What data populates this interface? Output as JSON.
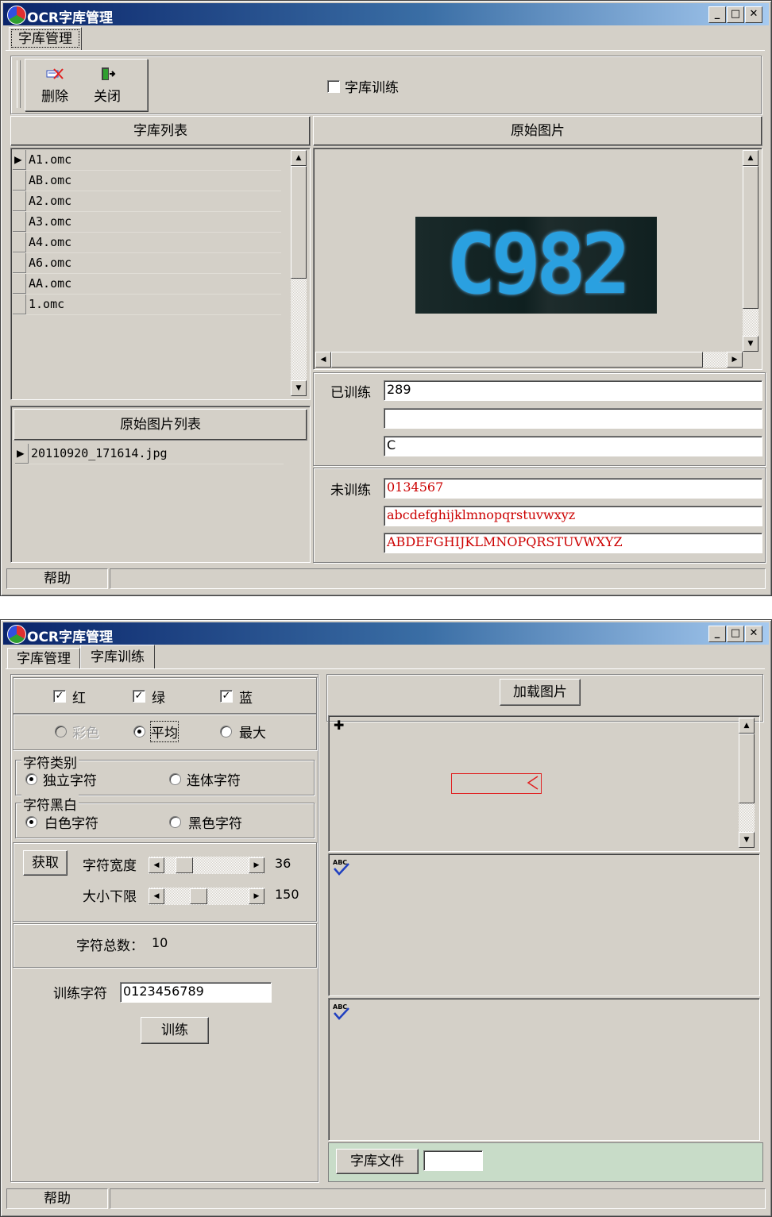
{
  "window1": {
    "title": "OCR字库管理",
    "tabs": [
      {
        "label": "字库管理",
        "active": true
      }
    ],
    "toolbar": {
      "delete_label": "删除",
      "close_label": "关闭"
    },
    "train_checkbox": {
      "label": "字库训练",
      "checked": false
    },
    "lib_list": {
      "header": "字库列表",
      "items": [
        "A1.omc",
        "AB.omc",
        "A2.omc",
        "A3.omc",
        "A4.omc",
        "A6.omc",
        "AA.omc",
        "1.omc"
      ]
    },
    "image_list": {
      "header": "原始图片列表",
      "items": [
        "20110920_171614.jpg"
      ]
    },
    "preview": {
      "header": "原始图片",
      "image_text": "C982"
    },
    "trained": {
      "label": "已训练",
      "values": [
        "289",
        "",
        "C"
      ]
    },
    "untrained": {
      "label": "未训练",
      "values": [
        "0134567",
        "abcdefghijklmnopqrstuvwxyz",
        "ABDEFGHIJKLMNOPQRSTUVWXYZ"
      ]
    },
    "status": {
      "help": "帮助"
    }
  },
  "window2": {
    "title": "OCR字库管理",
    "tabs": [
      {
        "label": "字库管理",
        "active": false
      },
      {
        "label": "字库训练",
        "active": true
      }
    ],
    "channels": [
      {
        "label": "红",
        "checked": true
      },
      {
        "label": "绿",
        "checked": true
      },
      {
        "label": "蓝",
        "checked": true
      }
    ],
    "modes": [
      {
        "label": "彩色",
        "selected": false,
        "disabled": true
      },
      {
        "label": "平均",
        "selected": true,
        "disabled": false
      },
      {
        "label": "最大",
        "selected": false,
        "disabled": false
      }
    ],
    "char_type": {
      "title": "字符类别",
      "options": [
        {
          "label": "独立字符",
          "selected": true
        },
        {
          "label": "连体字符",
          "selected": false
        }
      ]
    },
    "char_bw": {
      "title": "字符黑白",
      "options": [
        {
          "label": "白色字符",
          "selected": true
        },
        {
          "label": "黑色字符",
          "selected": false
        }
      ]
    },
    "fetch_button": "获取",
    "char_width": {
      "label": "字符宽度",
      "value": "36"
    },
    "size_limit": {
      "label": "大小下限",
      "value": "150"
    },
    "total": {
      "label": "字符总数：",
      "value": "10"
    },
    "train_chars": {
      "label": "训练字符",
      "value": "0123456789"
    },
    "train_button": "训练",
    "load_button": "加载图片",
    "lib_file": {
      "label": "字库文件",
      "value": ""
    },
    "status": {
      "help": "帮助"
    },
    "colors": {
      "selection_box": "#e02020",
      "footer_bg": "#c8dcc8"
    }
  }
}
